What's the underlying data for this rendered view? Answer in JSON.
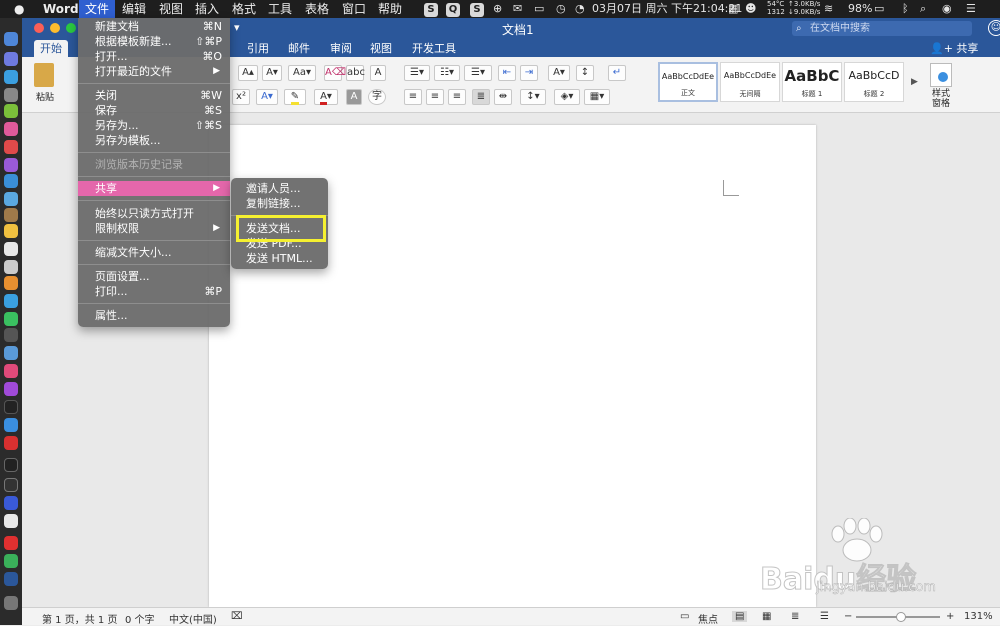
{
  "menubar": {
    "app_name": "Word",
    "items": [
      "文件",
      "编辑",
      "视图",
      "插入",
      "格式",
      "工具",
      "表格",
      "窗口",
      "帮助"
    ],
    "tray": {
      "temp": "54°C",
      "fan": "1312",
      "net_up": "↑3.0KB/s",
      "net_down": "↓9.0KB/s",
      "datetime": "03月07日 周六 下午21:04:21",
      "battery": "98%"
    }
  },
  "window": {
    "title": "文档1",
    "search_placeholder": "在文档中搜索",
    "share_label": "共享"
  },
  "ribbon": {
    "tabs": [
      "开始",
      "引用",
      "邮件",
      "审阅",
      "视图",
      "开发工具"
    ],
    "paste_label": "粘贴",
    "styles": [
      {
        "sample": "AaBbCcDdEe",
        "name": "正文"
      },
      {
        "sample": "AaBbCcDdEe",
        "name": "无间隔"
      },
      {
        "sample": "AaBbC",
        "name": "标题 1"
      },
      {
        "sample": "AaBbCcD",
        "name": "标题 2"
      }
    ],
    "styles_pane_label": "样式\n窗格"
  },
  "file_menu": {
    "items": [
      {
        "label": "新建文档",
        "shortcut": "⌘N"
      },
      {
        "label": "根据模板新建...",
        "shortcut": "⇧⌘P"
      },
      {
        "label": "打开...",
        "shortcut": "⌘O"
      },
      {
        "label": "打开最近的文件",
        "shortcut": "▶"
      },
      {
        "label": "关闭",
        "shortcut": "⌘W"
      },
      {
        "label": "保存",
        "shortcut": "⌘S"
      },
      {
        "label": "另存为...",
        "shortcut": "⇧⌘S"
      },
      {
        "label": "另存为模板...",
        "shortcut": ""
      },
      {
        "label": "浏览版本历史记录",
        "shortcut": ""
      },
      {
        "label": "共享",
        "shortcut": "▶"
      },
      {
        "label": "始终以只读方式打开",
        "shortcut": ""
      },
      {
        "label": "限制权限",
        "shortcut": "▶"
      },
      {
        "label": "缩减文件大小...",
        "shortcut": ""
      },
      {
        "label": "页面设置...",
        "shortcut": ""
      },
      {
        "label": "打印...",
        "shortcut": "⌘P"
      },
      {
        "label": "属性...",
        "shortcut": ""
      }
    ]
  },
  "share_submenu": {
    "items": [
      "邀请人员...",
      "复制链接...",
      "发送文档...",
      "发送 PDF...",
      "发送 HTML..."
    ]
  },
  "statusbar": {
    "page_info": "第 1 页，共 1 页",
    "word_count": "0 个字",
    "language": "中文(中国)",
    "focus_label": "焦点",
    "zoom": "131%"
  },
  "watermark": {
    "brand": "Baidu经验",
    "url": "jingyan.baidu.com"
  },
  "colors": {
    "word_blue": "#2b579a",
    "menu_highlight": "#e467ab",
    "annotation_yellow": "#f5f030",
    "menubar_bg": "#1e1e1e"
  }
}
